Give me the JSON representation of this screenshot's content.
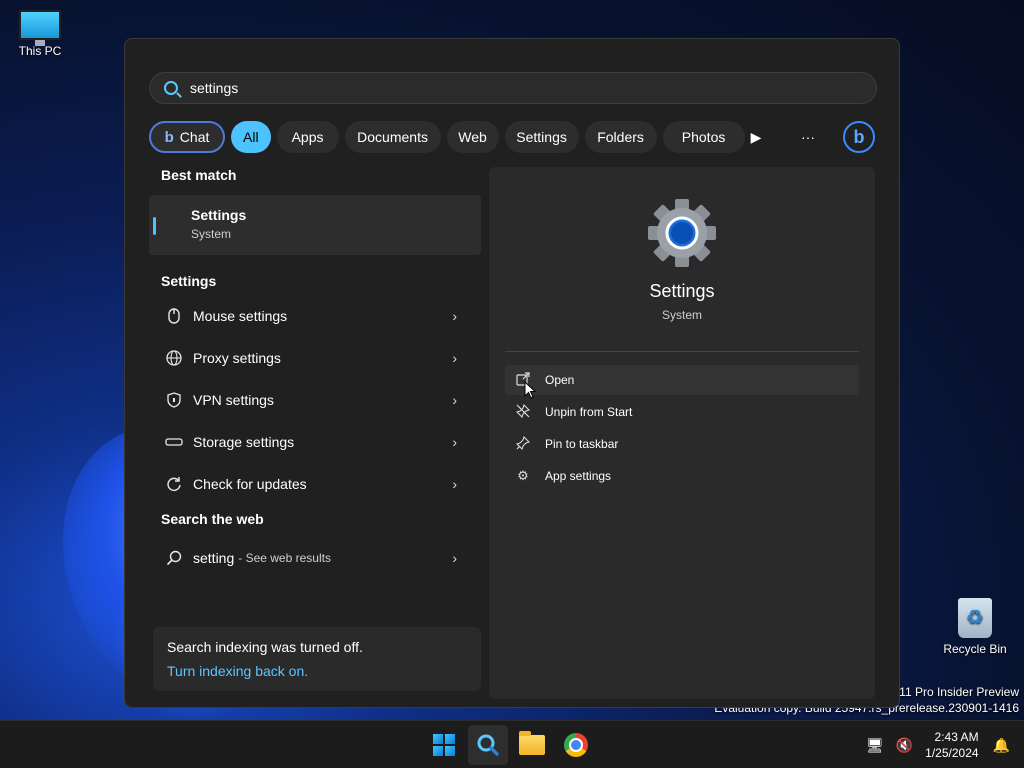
{
  "desktop": {
    "this_pc_label": "This PC",
    "recycle_bin_label": "Recycle Bin",
    "watermark_line1": "s 11 Pro Insider Preview",
    "watermark_line2": "Evaluation copy. Build 25947.rs_prerelease.230901-1416"
  },
  "search": {
    "query": "settings",
    "filters": [
      "Chat",
      "All",
      "Apps",
      "Documents",
      "Web",
      "Settings",
      "Folders",
      "Photos"
    ],
    "active_filter": "All"
  },
  "best_match": {
    "section_title": "Best match",
    "title": "Settings",
    "subtitle": "System"
  },
  "settings_section": {
    "title": "Settings",
    "items": [
      {
        "icon": "mouse-icon",
        "label": "Mouse settings"
      },
      {
        "icon": "globe-icon",
        "label": "Proxy settings"
      },
      {
        "icon": "shield-icon",
        "label": "VPN settings"
      },
      {
        "icon": "storage-icon",
        "label": "Storage settings"
      },
      {
        "icon": "refresh-icon",
        "label": "Check for updates"
      }
    ]
  },
  "web_section": {
    "title": "Search the web",
    "query": "setting",
    "hint": "- See web results"
  },
  "indexing": {
    "message": "Search indexing was turned off.",
    "link": "Turn indexing back on."
  },
  "preview": {
    "title": "Settings",
    "subtitle": "System",
    "actions": [
      {
        "icon": "open-icon",
        "label": "Open"
      },
      {
        "icon": "unpin-icon",
        "label": "Unpin from Start"
      },
      {
        "icon": "pin-icon",
        "label": "Pin to taskbar"
      },
      {
        "icon": "gear-icon",
        "label": "App settings"
      }
    ]
  },
  "taskbar": {
    "time": "2:43 AM",
    "date": "1/25/2024"
  },
  "colors": {
    "accent": "#4cc2ff",
    "panel": "#202020",
    "preview_bg": "#2a2a2a"
  }
}
